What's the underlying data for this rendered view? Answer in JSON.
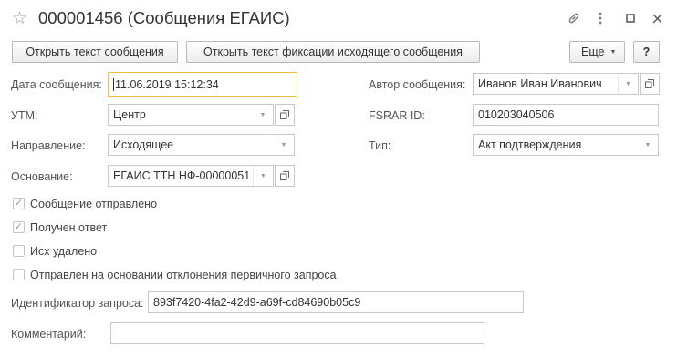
{
  "window": {
    "title": "000001456 (Сообщения ЕГАИС)",
    "icons": [
      "star-icon",
      "link-icon",
      "more-vertical-icon",
      "maximize-icon",
      "close-icon"
    ]
  },
  "toolbar": {
    "open_message_label": "Открыть текст сообщения",
    "open_fixation_label": "Открыть текст фиксации исходящего сообщения",
    "more_label": "Еще",
    "help_label": "?"
  },
  "form": {
    "date": {
      "label": "Дата сообщения:",
      "value": "11.06.2019 15:12:34"
    },
    "utm": {
      "label": "УТМ:",
      "value": "Центр"
    },
    "direction": {
      "label": "Направление:",
      "value": "Исходящее"
    },
    "basis": {
      "label": "Основание:",
      "value": "ЕГАИС ТТН НФ-00000051"
    },
    "author": {
      "label": "Автор сообщения:",
      "value": "Иванов Иван Иванович"
    },
    "fsrar": {
      "label": "FSRAR ID:",
      "value": "010203040506"
    },
    "type": {
      "label": "Тип:",
      "value": "Акт подтверждения"
    },
    "checkboxes": [
      {
        "label": "Сообщение отправлено",
        "checked": true
      },
      {
        "label": "Получен ответ",
        "checked": true
      },
      {
        "label": "Исх удалено",
        "checked": false
      },
      {
        "label": "Отправлен на основании отклонения первичного запроса",
        "checked": false
      }
    ],
    "request_id": {
      "label": "Идентификатор запроса:",
      "value": "893f7420-4fa2-42d9-a69f-cd84690b05c9"
    },
    "comment": {
      "label": "Комментарий:",
      "value": ""
    }
  },
  "colors": {
    "focus_border": "#f0c040",
    "field_border": "#c8c8c8"
  }
}
